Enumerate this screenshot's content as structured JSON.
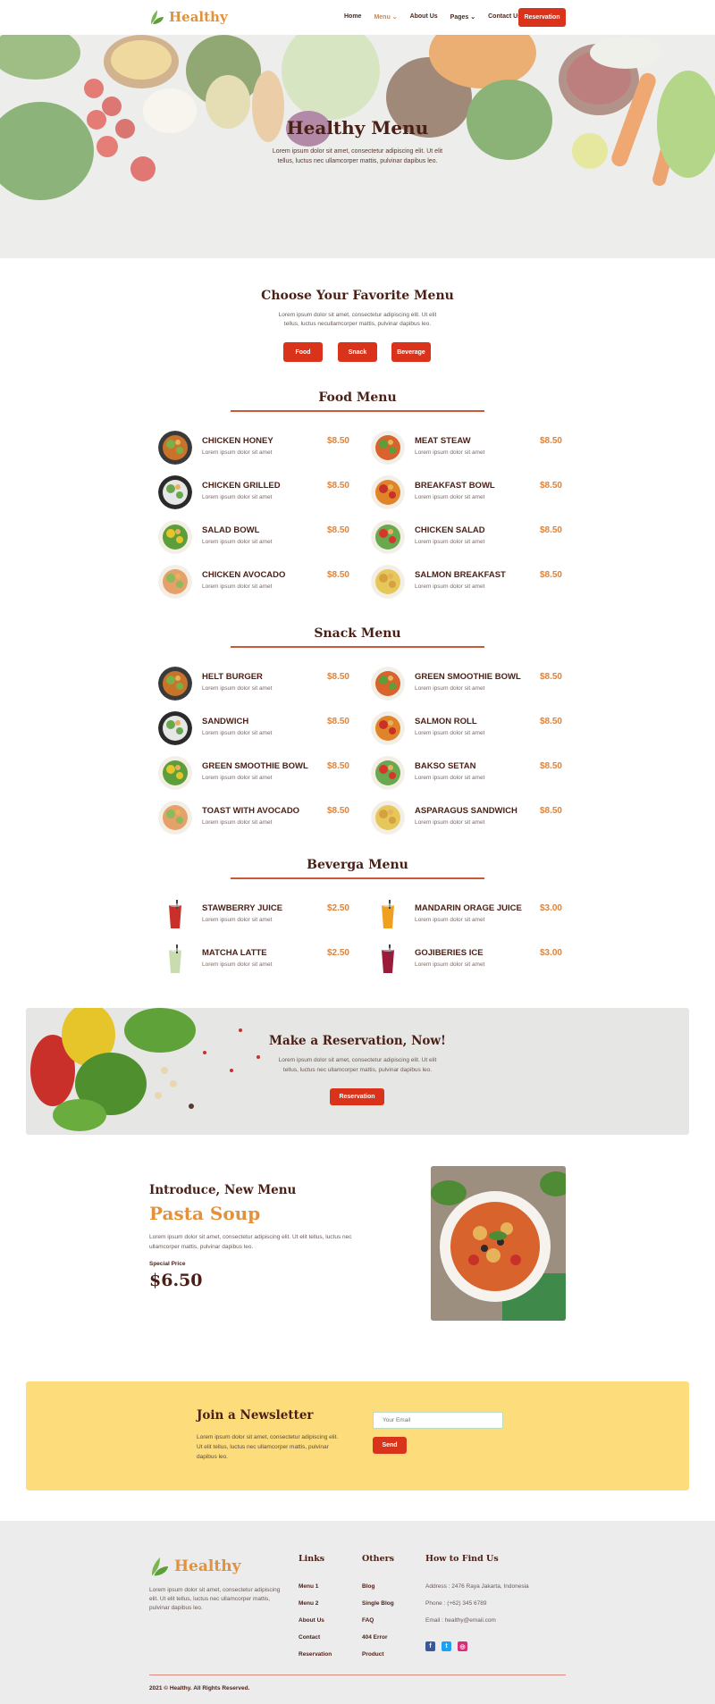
{
  "brand": {
    "name": "Healthy",
    "accent": "#e3913a",
    "primary": "#d9341b",
    "leaf_color": "#6aa84f"
  },
  "nav": {
    "items": [
      {
        "label": "Home",
        "active": false
      },
      {
        "label": "Menu",
        "active": true,
        "dropdown": true
      },
      {
        "label": "About Us",
        "active": false
      },
      {
        "label": "Pages",
        "active": false,
        "dropdown": true
      },
      {
        "label": "Contact Us",
        "active": false
      }
    ],
    "cta": "Reservation"
  },
  "hero": {
    "title": "Healthy Menu",
    "subtitle": "Lorem ipsum dolor sit amet, consectetur adipiscing elit. Ut elit tellus, luctus nec ullamcorper mattis, pulvinar dapibus leo."
  },
  "choose": {
    "title": "Choose Your Favorite Menu",
    "subtitle": "Lorem ipsum dolor sit amet, consectetur adipiscing elit. Ut elit tellus, luctus necullamcorper mattis, pulvinar dapibus leo.",
    "buttons": [
      "Food",
      "Snack",
      "Beverage"
    ]
  },
  "food_menu": {
    "title": "Food Menu",
    "items": [
      {
        "name": "CHICKEN HONEY",
        "desc": "Lorem ipsum dolor sit amet",
        "price": "$8.50"
      },
      {
        "name": "MEAT STEAW",
        "desc": "Lorem ipsum dolor sit amet",
        "price": "$8.50"
      },
      {
        "name": "CHICKEN GRILLED",
        "desc": "Lorem ipsum dolor sit amet",
        "price": "$8.50"
      },
      {
        "name": "BREAKFAST BOWL",
        "desc": "Lorem ipsum dolor sit amet",
        "price": "$8.50"
      },
      {
        "name": "SALAD BOWL",
        "desc": "Lorem ipsum dolor sit amet",
        "price": "$8.50"
      },
      {
        "name": "CHICKEN SALAD",
        "desc": "Lorem ipsum dolor sit amet",
        "price": "$8.50"
      },
      {
        "name": "CHICKEN AVOCADO",
        "desc": "Lorem ipsum dolor sit amet",
        "price": "$8.50"
      },
      {
        "name": "SALMON BREAKFAST",
        "desc": "Lorem ipsum dolor sit amet",
        "price": "$8.50"
      }
    ]
  },
  "snack_menu": {
    "title": "Snack Menu",
    "items": [
      {
        "name": "HELT BURGER",
        "desc": "Lorem ipsum dolor sit amet",
        "price": "$8.50"
      },
      {
        "name": "GREEN SMOOTHIE BOWL",
        "desc": "Lorem ipsum dolor sit amet",
        "price": "$8.50"
      },
      {
        "name": "SANDWICH",
        "desc": "Lorem ipsum dolor sit amet",
        "price": "$8.50"
      },
      {
        "name": "SALMON ROLL",
        "desc": "Lorem ipsum dolor sit amet",
        "price": "$8.50"
      },
      {
        "name": "GREEN SMOOTHIE BOWL",
        "desc": "Lorem ipsum dolor sit amet",
        "price": "$8.50"
      },
      {
        "name": "BAKSO SETAN",
        "desc": "Lorem ipsum dolor sit amet",
        "price": "$8.50"
      },
      {
        "name": "TOAST WITH AVOCADO",
        "desc": "Lorem ipsum dolor sit amet",
        "price": "$8.50"
      },
      {
        "name": "ASPARAGUS SANDWICH",
        "desc": "Lorem ipsum dolor sit amet",
        "price": "$8.50"
      }
    ]
  },
  "beverage_menu": {
    "title": "Beverga Menu",
    "items": [
      {
        "name": "STAWBERRY JUICE",
        "desc": "Lorem ipsum dolor sit amet",
        "price": "$2.50"
      },
      {
        "name": "MANDARIN ORAGE JUICE",
        "desc": "Lorem ipsum dolor sit amet",
        "price": "$3.00"
      },
      {
        "name": "MATCHA LATTE",
        "desc": "Lorem ipsum dolor sit amet",
        "price": "$2.50"
      },
      {
        "name": "GOJIBERIES ICE",
        "desc": "Lorem ipsum dolor sit amet",
        "price": "$3.00"
      }
    ]
  },
  "reservation": {
    "title": "Make a Reservation, Now!",
    "subtitle": "Lorem ipsum dolor sit amet, consectetur adipiscing elit. Ut elit tellus, luctus nec ullamcorper mattis, pulvinar dapibus leo.",
    "button": "Reservation"
  },
  "new_menu": {
    "label": "Introduce, New Menu",
    "name": "Pasta Soup",
    "desc": "Lorem ipsum dolor sit amet, consectetur adipiscing elit. Ut elit tellus, luctus nec ullamcorper mattis, pulvinar dapibus leo.",
    "price_label": "Special Price",
    "price": "$6.50"
  },
  "newsletter": {
    "title": "Join a Newsletter",
    "desc": "Lorem ipsum dolor sit amet, consectetur adipiscing elit. Ut elit tellus, luctus nec ullamcorper mattis, pulvinar dapibus leo.",
    "placeholder": "Your Email",
    "button": "Send"
  },
  "footer": {
    "desc": "Lorem ipsum dolor sit amet, consectetur adipiscing elit. Ut elit tellus, luctus nec ullamcorper mattis, pulvinar dapibus leo.",
    "links_title": "Links",
    "links": [
      "Menu 1",
      "Menu 2",
      "About Us",
      "Contact",
      "Reservation"
    ],
    "others_title": "Others",
    "others": [
      "Blog",
      "Single Blog",
      "FAQ",
      "404 Error",
      "Product"
    ],
    "find_title": "How to Find Us",
    "address": "Address : 2476 Raya Jakarta, Indonesia",
    "phone": "Phone : (+62) 345 6789",
    "email": "Email : healthy@email.com",
    "social": [
      {
        "icon": "facebook-icon",
        "glyph": "f",
        "color": "#3b5998"
      },
      {
        "icon": "twitter-icon",
        "glyph": "t",
        "color": "#1da1f2"
      },
      {
        "icon": "instagram-icon",
        "glyph": "◎",
        "color": "#d6307a"
      }
    ],
    "copyright": "2021 © Healthy. All Rights Reserved."
  }
}
